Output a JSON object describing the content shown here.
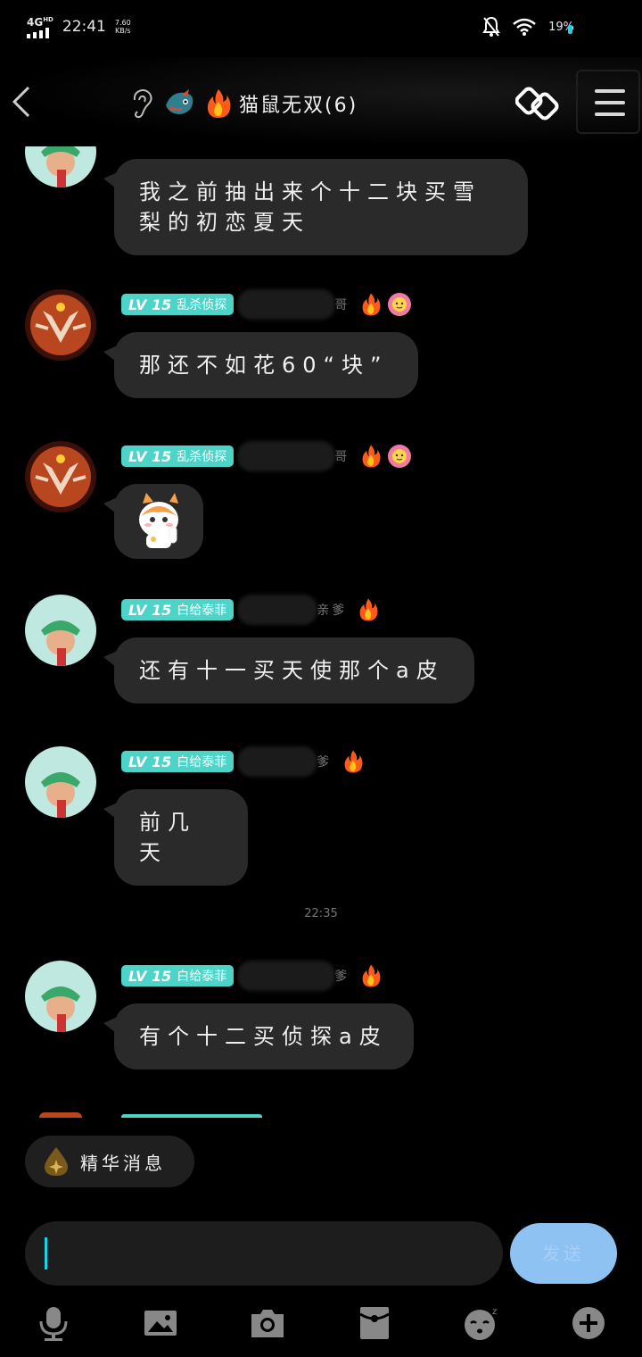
{
  "status_bar": {
    "network": "4G",
    "network_sup": "HD",
    "time": "22:41",
    "speed_value": "7.60",
    "speed_unit": "KB/s",
    "battery": "19%"
  },
  "header": {
    "title": "猫鼠无双(6)",
    "back_icon": "chevron-left-icon",
    "ear_icon": "ear-icon",
    "link_icon": "chain-link-icon",
    "menu_icon": "hamburger-icon"
  },
  "messages": [
    {
      "text_line1": "我之前抽出来个十二块买雪",
      "text_line2": "梨的初恋夏天"
    },
    {
      "level": "LV 15",
      "title": "乱杀侦探",
      "nick": "亲哥",
      "text": "那还不如花60“块”"
    },
    {
      "level": "LV 15",
      "title": "乱杀侦探",
      "nick": "亲哥",
      "sticker": "cat-sticker"
    },
    {
      "level": "LV 15",
      "title": "白给泰菲",
      "nick": "勺亲爹",
      "text": "还有十一买天使那个a皮"
    },
    {
      "level": "LV 15",
      "title": "白给泰菲",
      "nick": "亲爹",
      "text": "前几天"
    },
    {
      "level": "LV 15",
      "title": "白给泰菲",
      "nick": "、爹",
      "text": "有个十二买侦探a皮"
    }
  ],
  "timestamp": "22:35",
  "essence_button": "精华消息",
  "input": {
    "value": ""
  },
  "send_label": "发送",
  "toolbar": [
    "microphone-icon",
    "image-icon",
    "camera-icon",
    "red-packet-icon",
    "emoji-icon",
    "plus-icon"
  ],
  "accent_color": "#4ed3c8"
}
